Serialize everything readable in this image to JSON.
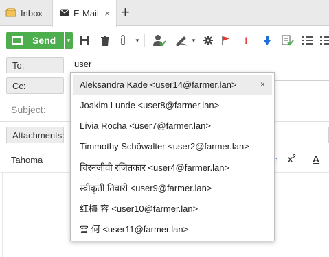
{
  "tabs": [
    {
      "label": "Inbox",
      "icon": "inbox-icon"
    },
    {
      "label": "E-Mail",
      "icon": "mail-icon",
      "close": "×"
    }
  ],
  "tab_add": "+",
  "toolbar": {
    "send_label": "Send",
    "colors": {
      "send": "#4cae4c",
      "flag": "#e53935",
      "important": "#e53935",
      "arrow": "#1e6fd9"
    }
  },
  "form": {
    "to_label": "To:",
    "to_value": "user",
    "cc_label": "Cc:",
    "subject_placeholder": "Subject:",
    "attachments_label": "Attachments:"
  },
  "formatting": {
    "font": "Tahoma",
    "superscript": "x",
    "superscript_mark": "2",
    "text_color": "A"
  },
  "autocomplete": {
    "items": [
      {
        "label": "Aleksandra Kade <user14@farmer.lan>",
        "active": true,
        "remove": "×"
      },
      {
        "label": "Joakim Lunde <user8@farmer.lan>"
      },
      {
        "label": "Lívia Rocha <user7@farmer.lan>"
      },
      {
        "label": "Timmothy Schöwalter <user2@farmer.lan>"
      },
      {
        "label": "चिरनजीवी रजितकार <user4@farmer.lan>"
      },
      {
        "label": "स्वीकृती तिवारी <user9@farmer.lan>"
      },
      {
        "label": "红梅 容 <user10@farmer.lan>"
      },
      {
        "label": "雪 何 <user11@farmer.lan>"
      }
    ]
  }
}
